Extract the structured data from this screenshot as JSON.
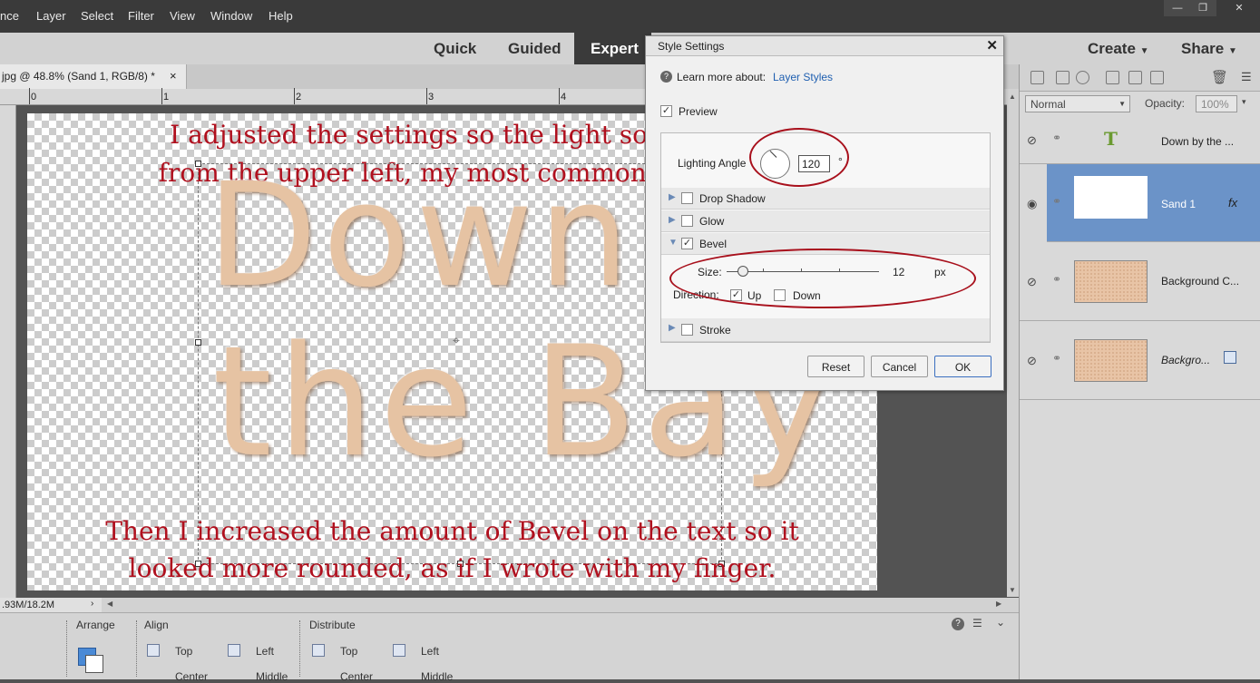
{
  "menubar": {
    "items": [
      "nce",
      "Layer",
      "Select",
      "Filter",
      "View",
      "Window",
      "Help"
    ],
    "window_buttons": [
      "—",
      "❐",
      "✕"
    ]
  },
  "modebar": {
    "quick": "Quick",
    "guided": "Guided",
    "expert": "Expert",
    "create": "Create",
    "share": "Share"
  },
  "document": {
    "tab_title": "jpg @ 48.8% (Sand 1, RGB/8) *",
    "tab_close": "×",
    "ruler_numbers": [
      "0",
      "1",
      "2",
      "3",
      "4"
    ],
    "status": ".93M/18.2M"
  },
  "canvas": {
    "note_top_line1": "I adjusted the settings so the light source is",
    "note_top_line2": "from the upper left, my most common choice.",
    "big_text_line1": "Down b",
    "big_text_line2": "the Bay",
    "note_bottom_line1": "Then I increased the amount of Bevel on the text so it",
    "note_bottom_line2": "looked more rounded, as if I wrote with my finger."
  },
  "dialog": {
    "title": "Style Settings",
    "close": "✕",
    "learn_more": "Learn more about:",
    "learn_more_link": "Layer Styles",
    "preview_label": "Preview",
    "preview_checked": true,
    "lighting_angle_label": "Lighting Angle",
    "lighting_angle_value": "120",
    "degree_symbol": "°",
    "sections": [
      {
        "label": "Drop Shadow",
        "checked": false
      },
      {
        "label": "Glow",
        "checked": false
      },
      {
        "label": "Bevel",
        "checked": true
      },
      {
        "label": "Stroke",
        "checked": false
      }
    ],
    "bevel": {
      "size_label": "Size:",
      "size_value": "12",
      "size_unit": "px",
      "direction_label": "Direction:",
      "up_label": "Up",
      "up_checked": true,
      "down_label": "Down",
      "down_checked": false
    },
    "buttons": {
      "reset": "Reset",
      "cancel": "Cancel",
      "ok": "OK"
    }
  },
  "layers_panel": {
    "blend_mode": "Normal",
    "opacity_label": "Opacity:",
    "opacity_value": "100%",
    "layers": [
      {
        "name": "Down by the ...",
        "type": "text",
        "selected": false
      },
      {
        "name": "Sand 1",
        "type": "image",
        "selected": true,
        "fx": "fx"
      },
      {
        "name": "Background C...",
        "type": "image",
        "selected": false
      },
      {
        "name": "Backgro...",
        "type": "image",
        "selected": false
      }
    ]
  },
  "bottom_panel": {
    "arrange": "Arrange",
    "align": "Align",
    "distribute": "Distribute",
    "align_items": [
      "Top",
      "Left",
      "Center",
      "Middle"
    ],
    "distribute_items": [
      "Top",
      "Left",
      "Center",
      "Middle"
    ]
  },
  "colors": {
    "accent_red": "#a8101c",
    "selection_blue": "#6b93c8",
    "annotation_text": "#b0101e"
  }
}
